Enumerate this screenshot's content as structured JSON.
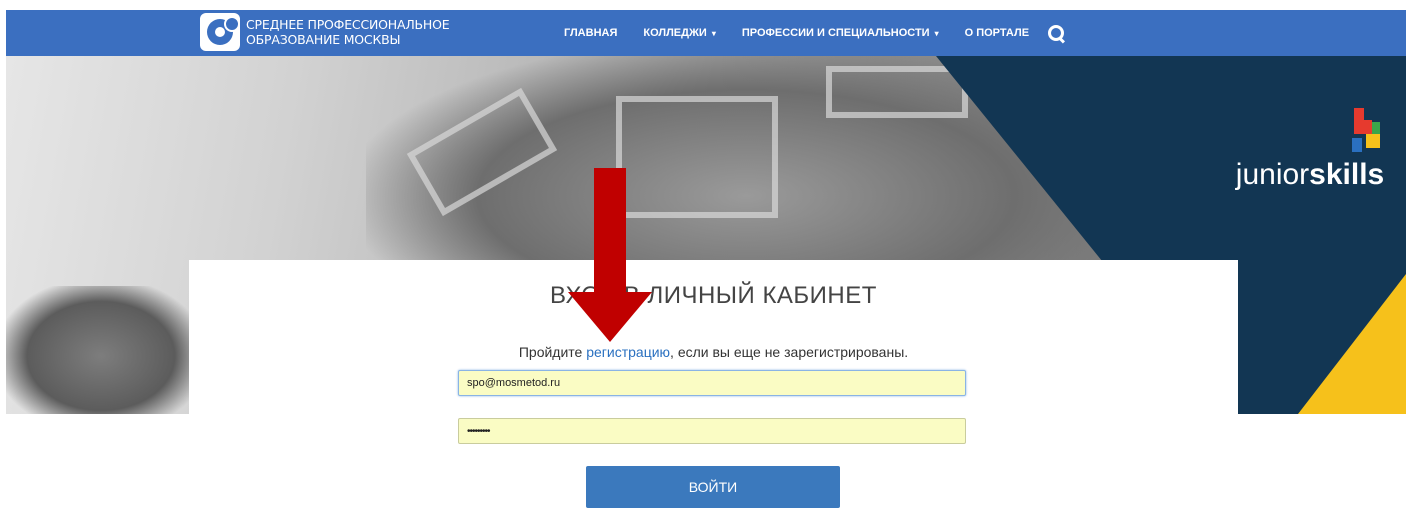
{
  "brand": {
    "line1": "СРЕДНЕЕ ПРОФЕССИОНАЛЬНОЕ",
    "line2": "ОБРАЗОВАНИЕ МОСКВЫ"
  },
  "nav": {
    "items": [
      {
        "label": "ГЛАВНАЯ",
        "dropdown": false
      },
      {
        "label": "КОЛЛЕДЖИ",
        "dropdown": true
      },
      {
        "label": "ПРОФЕССИИ И СПЕЦИАЛЬНОСТИ",
        "dropdown": true
      },
      {
        "label": "О ПОРТАЛЕ",
        "dropdown": false
      }
    ],
    "caret": "▾",
    "search_icon": "search-icon"
  },
  "hero": {
    "logo_light": "junior",
    "logo_bold": "skills"
  },
  "login": {
    "title": "ВХОД В ЛИЧНЫЙ КАБИНЕТ",
    "hint_before": "Пройдите ",
    "hint_link": "регистрацию",
    "hint_after": ", если вы еще не зарегистрированы.",
    "email_value": "spo@mosmetod.ru",
    "password_value": "•••••••••",
    "submit_label": "ВОЙТИ"
  },
  "colors": {
    "topbar": "#3b6fc0",
    "button": "#3b79bd",
    "link": "#2a70c0",
    "arrow": "#c00000",
    "accent_yellow": "#f6c11b",
    "navy": "#123653"
  }
}
